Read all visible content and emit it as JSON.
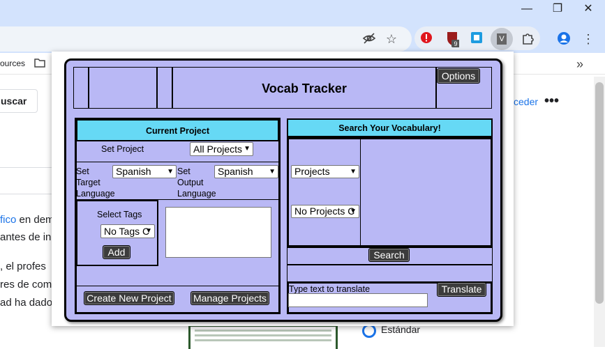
{
  "browser": {
    "window_controls": {
      "minimize": "—",
      "restore": "❐",
      "close": "✕"
    },
    "extension_badge": "9",
    "ext_v_label": "V",
    "bookmarks": {
      "item1": "ources"
    },
    "more_icon": "»"
  },
  "underlying_page": {
    "buscar": "uscar",
    "ceder": "ceder",
    "line1_link": "fico",
    "line1_rest": " en dem",
    "line2": " antes de in",
    "line3": ", el profes",
    "line4": "res de com",
    "line5": "ad ha dado",
    "estandar": "Estándar"
  },
  "app": {
    "title": "Vocab Tracker",
    "options_button": "Options",
    "current_project": {
      "header": "Current Project",
      "set_project_label": "Set Project",
      "project_select": "All Projects",
      "target_label": "Set Target Language",
      "target_select": "Spanish",
      "output_label": "Set Output Language",
      "output_select": "Spanish",
      "select_tags_label": "Select Tags",
      "tags_select": "No Tags C",
      "add_button": "Add",
      "create_button": "Create New Project",
      "manage_button": "Manage Projects"
    },
    "search": {
      "header": "Search Your Vocabulary!",
      "projects_select": "Projects",
      "no_projects_select": "No Projects C",
      "search_button": "Search",
      "translate_label": "Type text to translate",
      "translate_button": "Translate"
    }
  }
}
